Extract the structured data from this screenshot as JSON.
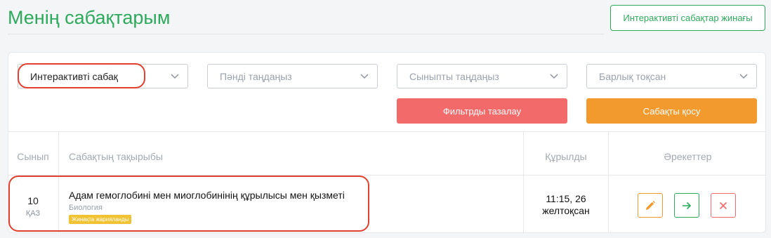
{
  "header": {
    "title": "Менің сабақтарым",
    "collection_button": "Интерактивті сабақтар жинағы"
  },
  "filters": {
    "type": {
      "value": "Интерактивті сабақ"
    },
    "subject": {
      "placeholder": "Пәнді таңдаңыз"
    },
    "grade": {
      "placeholder": "Сыныпты таңдаңыз"
    },
    "quarter": {
      "placeholder": "Барлық тоқсан"
    },
    "clear_button": "Фильтрды тазалау",
    "add_button": "Сабақты қосу"
  },
  "table": {
    "columns": [
      "Сынып",
      "Сабақтың тақырыбы",
      "Құрылды",
      "Әрекеттер"
    ],
    "rows": [
      {
        "grade": "10",
        "lang": "ҚАЗ",
        "title": "Адам гемоглобині мен миоглобинінің құрылысы мен қызметі",
        "subject": "Биология",
        "badge": "Жинақта жарияланды",
        "created_time": "11:15, 26",
        "created_date": "желтоқсан"
      }
    ]
  },
  "icons": {
    "edit": "pencil-icon",
    "open": "arrow-right-icon",
    "delete": "close-icon",
    "dropdown": "chevron-down-icon"
  },
  "colors": {
    "brand_green": "#2eaa5c",
    "clear_red": "#f26a6a",
    "add_orange": "#f39a2e",
    "badge_yellow": "#f1c232",
    "highlight_red": "#e2402f"
  }
}
